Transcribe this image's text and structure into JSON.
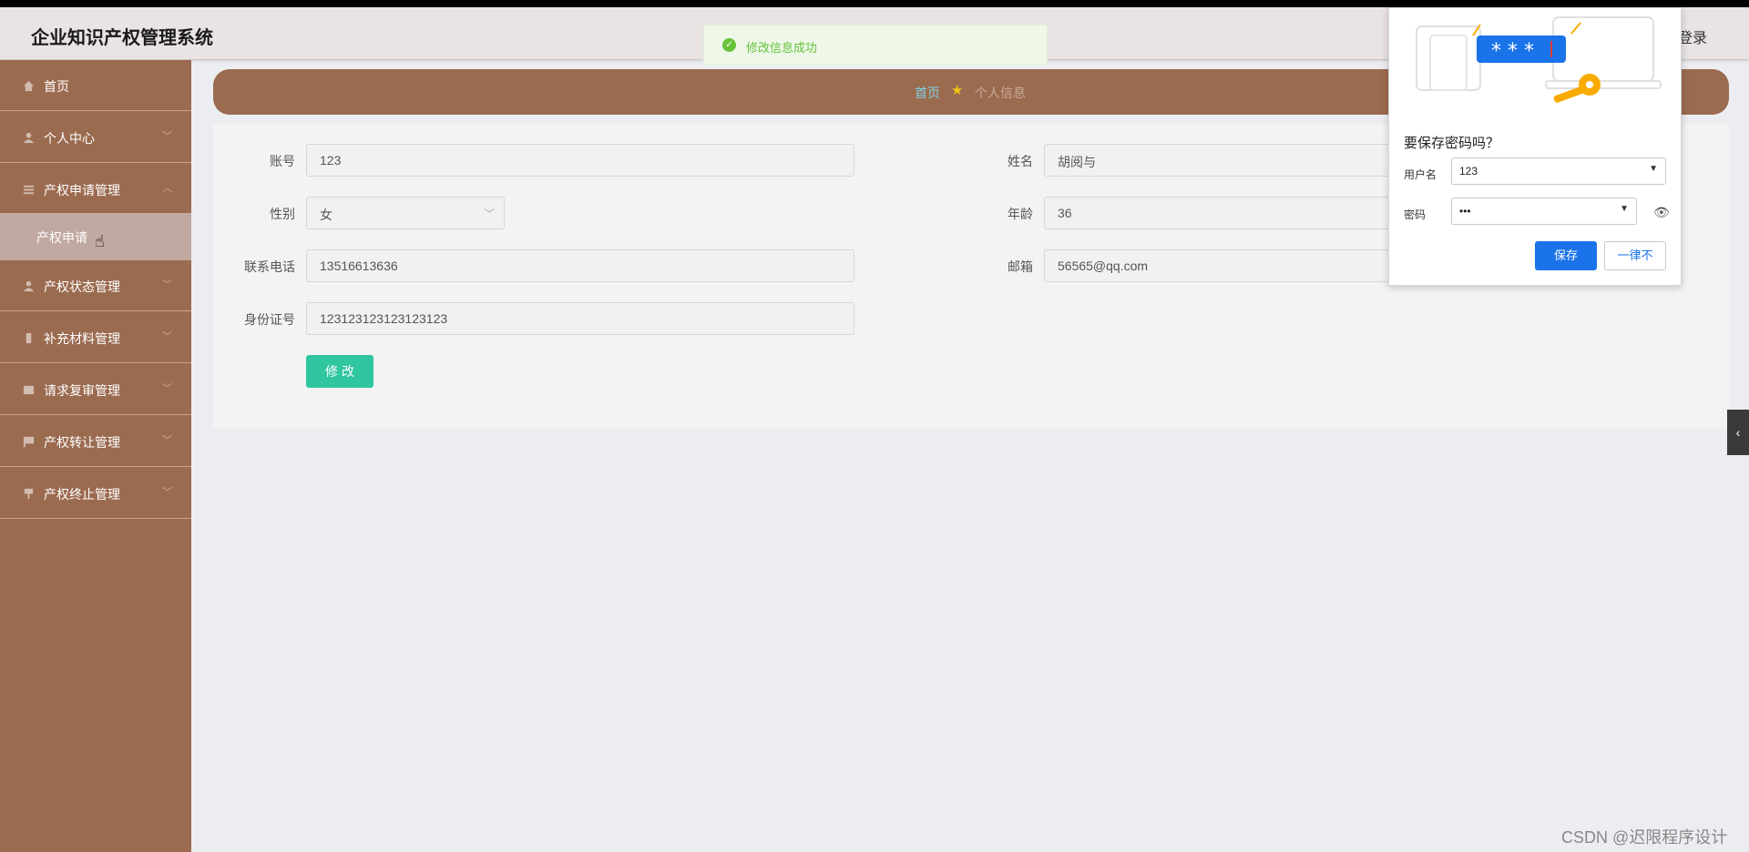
{
  "app": {
    "title": "企业知识产权管理系统",
    "logout_label": "登录"
  },
  "toast": {
    "message": "修改信息成功"
  },
  "sidebar": {
    "items": [
      {
        "label": "首页",
        "icon": "home-icon"
      },
      {
        "label": "个人中心",
        "icon": "user-icon"
      },
      {
        "label": "产权申请管理",
        "icon": "list-icon"
      },
      {
        "label": "产权状态管理",
        "icon": "user-icon"
      },
      {
        "label": "补充材料管理",
        "icon": "phone-icon"
      },
      {
        "label": "请求复审管理",
        "icon": "grid-icon"
      },
      {
        "label": "产权转让管理",
        "icon": "flag-icon"
      },
      {
        "label": "产权终止管理",
        "icon": "sign-icon"
      }
    ],
    "active_subitem": {
      "label": "产权申请"
    }
  },
  "breadcrumb": {
    "home": "首页",
    "current": "个人信息"
  },
  "form": {
    "account_label": "账号",
    "account_value": "123",
    "name_label": "姓名",
    "name_value": "胡阅与",
    "gender_label": "性别",
    "gender_value": "女",
    "age_label": "年龄",
    "age_value": "36",
    "phone_label": "联系电话",
    "phone_value": "13516613636",
    "email_label": "邮箱",
    "email_value": "56565@qq.com",
    "idcard_label": "身份证号",
    "idcard_value": "123123123123123123",
    "submit_label": "修 改"
  },
  "password_popup": {
    "title": "要保存密码吗？",
    "username_label": "用户名",
    "username_value": "123",
    "password_label": "密码",
    "password_value": "•••",
    "save_label": "保存",
    "never_label": "一律不",
    "illustration_mask": "* * *"
  },
  "watermark": "CSDN @迟限程序设计",
  "colors": {
    "sidebar": "#9b6b50",
    "accent": "#2fc6a0",
    "toast": "#67c23a",
    "chrome_blue": "#1a73e8"
  }
}
